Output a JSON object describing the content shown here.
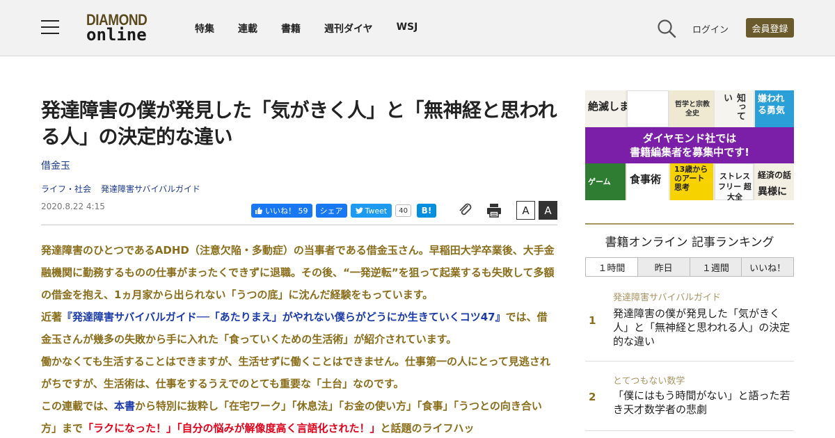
{
  "header": {
    "logo_top": "DIAMOND",
    "logo_bottom": "online",
    "nav": [
      "特集",
      "連載",
      "書籍",
      "週刊ダイヤ",
      "WSJ"
    ],
    "login": "ログイン",
    "register": "会員登録"
  },
  "article": {
    "title": "発達障害の僕が発見した「気がきく人」と「無神経と思われる人」の決定的な違い",
    "author": "借金玉",
    "tags": [
      "ライフ・社会",
      "発達障害サバイバルガイド"
    ],
    "date": "2020.8.22 4:15",
    "share": {
      "fb_like": "いいね！",
      "fb_count": "59",
      "fb_share": "シェア",
      "tweet": "Tweet",
      "tweet_count": "40",
      "hatena": "B!"
    },
    "font_small": "A",
    "font_large": "A",
    "lead": {
      "p1": "発達障害のひとつであるADHD（注意欠陥・多動症）の当事者である借金玉さん。早稲田大学卒業後、大手金融機関に勤務するものの仕事がまったくできずに退職。その後、“一発逆転”を狙って起業するも失敗して多額の借金を抱え、1ヵ月家から出られない「うつの底」に沈んだ経験をもっています。",
      "p2_a": "近著",
      "p2_link": "『発達障害サバイバルガイド──「あたりまえ」がやれない僕らがどうにか生きていくコツ47』",
      "p2_b": "では、借金玉さんが幾多の失敗から手に入れた「食っていくための生活術」が紹介されています。",
      "p3": "働かなくても生活することはできますが、生活せずに働くことはできません。仕事第一の人にとって見逃されがちですが、生活術は、仕事をするうえでのとても重要な「土台」なのです。",
      "p4_a": "この連載では、",
      "p4_link": "本書",
      "p4_b": "から特別に抜粋し「在宅ワーク」「休息法」「お金の使い方」「食事」「うつとの向き合い方」まで",
      "p4_red": "「ラクになった！」「自分の悩みが解像度高く言語化された！」",
      "p4_c": "と話題のライフハッ"
    }
  },
  "sidebar": {
    "banner": {
      "line1": "ダイヤモンド社では",
      "line2": "書籍編集者を募集中です!",
      "book_texts": [
        "絶滅しま",
        "哲学と宗教 全史",
        "知ってい",
        "嫌われる勇気",
        "食事術",
        "ストレスフリー 超大全",
        "経済の話",
        "異様に",
        "ゲーム",
        "13歳からのアート思考"
      ]
    },
    "ranking": {
      "title": "書籍オンライン 記事ランキング",
      "tabs": [
        "１時間",
        "昨日",
        "１週間",
        "いいね！"
      ],
      "items": [
        {
          "num": "1",
          "category": "発達障害サバイバルガイド",
          "text": "発達障害の僕が発見した「気がきく人」と「無神経と思われる人」の決定的な違い"
        },
        {
          "num": "2",
          "category": "とてつもない数学",
          "text": "「僕にはもう時間がない」と語った若き天才数学者の悲劇"
        }
      ]
    }
  },
  "colors": {
    "brand_gold": "#8a6d1a",
    "link_blue": "#1a3aa8",
    "banner_purple": "#7b1fa8",
    "register_bg": "#6b5a2c"
  }
}
